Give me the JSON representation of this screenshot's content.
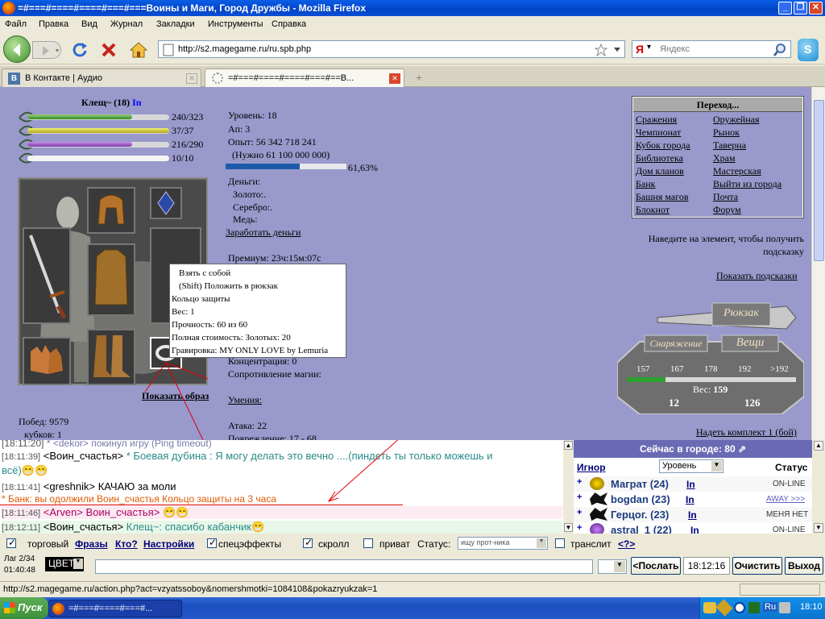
{
  "window": {
    "title": "=#===#====#====#===#===Воины и Маги, Город Дружбы - Mozilla Firefox"
  },
  "menu": [
    "Файл",
    "Правка",
    "Вид",
    "Журнал",
    "Закладки",
    "Инструменты",
    "Справка"
  ],
  "nav": {
    "url": "http://s2.magegame.ru/ru.spb.php",
    "search_placeholder": "Яндекс"
  },
  "tabs": [
    {
      "label": "В Контакте | Аудио"
    },
    {
      "label": "=#===#====#====#===#==В..."
    }
  ],
  "character": {
    "name": "Клещ~ (18)",
    "badge": "In",
    "hp": "240/323",
    "mana": "37/37",
    "stamina": "216/290",
    "exp_stat": "10/10",
    "hp_fill": 0.74,
    "mana_fill": 1.0,
    "stamina_fill": 0.74,
    "exp_stat_fill": 1.0,
    "level": "Уровень: 18",
    "ap": "Ап: 3",
    "exp": "Опыт: 56 342 718 241",
    "exp_need": "(Нужно 61 100 000 000)",
    "exp_percent": "61,63%",
    "exp_fill": 0.6163,
    "money_title": "Деньги:",
    "gold": "Золото:.",
    "silver": "Серебро:.",
    "copper": "Медь:",
    "earn_link": "Заработать деньги",
    "premium": "Премиум: 23ч:15м:07с",
    "concentration": "Концентрация: 0",
    "magic_resist": "Сопротивление магии:",
    "skills_link": "Умения:",
    "attack": "Атака: 22",
    "damage": "Повреждение: 17 - 68",
    "show_image": "Показать образ",
    "wins": "Побед: 9579",
    "cups": "кубков: 1"
  },
  "tooltip": {
    "line1": "Взять с собой",
    "line2": "(Shift) Положить в рюкзак",
    "name": "Кольцо защиты",
    "weight": "Вес: 1",
    "durability": "Прочность: 60 из 60",
    "cost": "Полная стоимость: Золотых: 20",
    "engraving": "Гравировка: MY ONLY LOVE by Lemuria"
  },
  "navigation": {
    "title": "Переход...",
    "left": [
      "Сражения",
      "Чемпионат",
      "Кубок города",
      "Библиотека",
      "Дом кланов",
      "Банк",
      "Башня магов",
      "Блокнот"
    ],
    "right": [
      "Оружейная",
      "Рынок",
      "Таверна",
      "Храм",
      "Мастерская",
      "Выйти из города",
      "Почта",
      "Форум"
    ]
  },
  "hint": "Наведите на элемент, чтобы получить подсказку",
  "show_hints": "Показать подсказки",
  "backpack": {
    "title": "Рюкзак",
    "equipment": "Снаряжение",
    "things": "Вещи",
    "scale": [
      "157",
      "167",
      "178",
      "192",
      ">192"
    ],
    "scale_fill": 0.23,
    "weight_label": "Вес:",
    "weight": "159",
    "left_val": "12",
    "right_val": "126"
  },
  "wear_set": "Надеть комплект 1 (бой)",
  "chat": [
    {
      "time": "[18:11:20]",
      "text": "* <dekor> покинул игру (Ping timeout)",
      "color": "#7777aa"
    },
    {
      "time": "[18:11:39]",
      "nick": "<Воин_счастья>",
      "text": " * Боевая дубина : Я могу делать это вечно ....(пиндеть ты только можешь и",
      "text2": "всё)",
      "color": "#2a8a8a"
    },
    {
      "time": "[18:11:41]",
      "nick": "<greshnik>",
      "text": " КАЧАЮ за моли",
      "color": "#000000"
    },
    {
      "time": "",
      "text": "* Банк: вы одолжили Воин_счастья Кольцо защиты на 3 часа",
      "color": "#e05a00"
    },
    {
      "time": "[18:11:46]",
      "nick": "<Arven>",
      "text": " Воин_счастья>",
      "color": "#aa0066"
    },
    {
      "time": "[18:12:11]",
      "nick": "<Воин_счастья>",
      "text": " Клещ~: спасибо кабанчик",
      "color": "#2a8a8a"
    }
  ],
  "users": {
    "header": "Сейчас в городе: 80",
    "ignore": "Игнор",
    "sort": "Уровень",
    "status_col": "Статус",
    "list": [
      {
        "name": "Маграт (24)",
        "badge": "In",
        "status": "ON-LINE"
      },
      {
        "name": "bogdan (23)",
        "badge": "In",
        "status": "AWAY >>>"
      },
      {
        "name": "Герцог. (23)",
        "badge": "In",
        "status": "МЕНЯ НЕТ"
      },
      {
        "name": "astral_1 (22)",
        "badge": "In",
        "status": "ON-LINE"
      }
    ]
  },
  "options": {
    "trade": "торговый",
    "phrases": "Фразы",
    "who": "Кто?",
    "settings": "Настройки",
    "effects": "спецэффекты",
    "scroll": "скролл",
    "private": "приват",
    "status_label": "Статус:",
    "status_placeholder": "ищу прот-ника",
    "translit": "транслит",
    "help": "<?>"
  },
  "input": {
    "lag": "Лаг 2/34",
    "lag_time": "01:40:48",
    "color": "ЦВЕТ",
    "send": "<Послать",
    "clock": "18:12:16",
    "clear": "Очистить",
    "exit": "Выход"
  },
  "status_url": "http://s2.magegame.ru/action.php?act=vzyatssoboy&nomershmotki=1084108&pokazryukzak=1",
  "taskbar": {
    "start": "Пуск",
    "task": "=#===#====#===#...",
    "lang": "Ru",
    "time": "18:10"
  }
}
